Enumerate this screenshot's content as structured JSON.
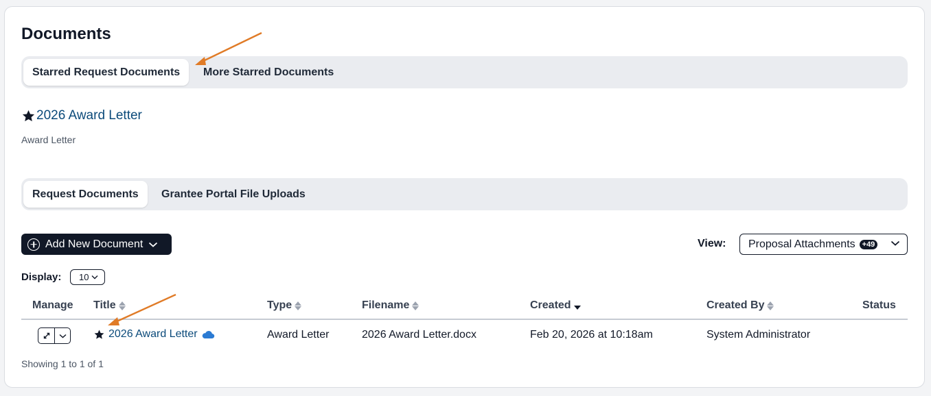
{
  "page": {
    "title": "Documents"
  },
  "starred_tabs": [
    {
      "label": "Starred Request Documents",
      "active": true
    },
    {
      "label": "More Starred Documents",
      "active": false
    }
  ],
  "starred_document": {
    "title": "2026 Award Letter",
    "type": "Award Letter"
  },
  "doc_tabs": [
    {
      "label": "Request Documents",
      "active": true
    },
    {
      "label": "Grantee Portal File Uploads",
      "active": false
    }
  ],
  "toolbar": {
    "add_label": "Add New Document",
    "view_label": "View:",
    "view_value": "Proposal Attachments",
    "view_badge": "+49",
    "display_label": "Display:",
    "display_value": "10"
  },
  "table": {
    "columns": [
      "Manage",
      "Title",
      "Type",
      "Filename",
      "Created",
      "Created By",
      "Status"
    ],
    "rows": [
      {
        "title": "2026 Award Letter",
        "type": "Award Letter",
        "filename": "2026 Award Letter.docx",
        "created": "Feb 20, 2026 at 10:18am",
        "created_by": "System Administrator",
        "status": ""
      }
    ],
    "footer": "Showing 1 to 1 of 1"
  },
  "colors": {
    "link": "#0b4a7a",
    "annotation_arrow": "#e07b27",
    "dark": "#111827",
    "cloud": "#2b7bd3"
  },
  "icons": [
    "star-icon",
    "plus-circle-icon",
    "chevron-down-icon",
    "expand-icon",
    "cloud-icon",
    "sort-icon",
    "arrow-annotation"
  ]
}
